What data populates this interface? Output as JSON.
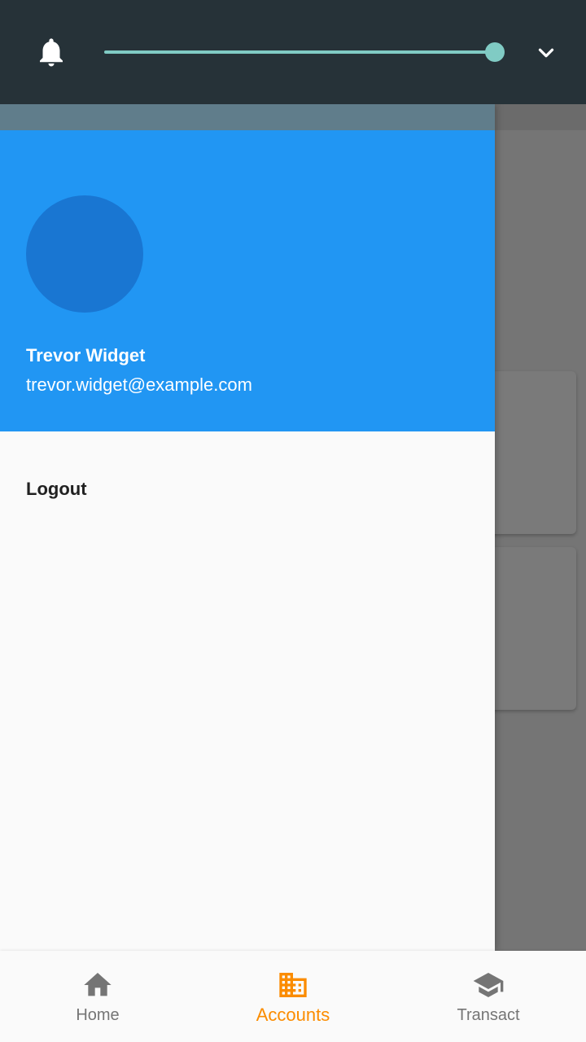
{
  "topbar": {
    "bell_icon": "bell-icon",
    "chevron_icon": "chevron-down-icon",
    "slider": {
      "value": 1.0
    }
  },
  "drawer": {
    "user": {
      "name": "Trevor Widget",
      "email": "trevor.widget@example.com"
    },
    "items": [
      {
        "label": "Logout"
      }
    ]
  },
  "bottom_nav": {
    "items": [
      {
        "label": "Home",
        "icon": "home-icon",
        "active": false
      },
      {
        "label": "Accounts",
        "icon": "building-icon",
        "active": true
      },
      {
        "label": "Transact",
        "icon": "school-icon",
        "active": false
      }
    ]
  },
  "colors": {
    "topbar_bg": "#263238",
    "slider": "#80cbc4",
    "drawer_header": "#2196f3",
    "avatar": "#1976d2",
    "active_nav": "#fb8c00",
    "inactive_nav": "#757575"
  }
}
